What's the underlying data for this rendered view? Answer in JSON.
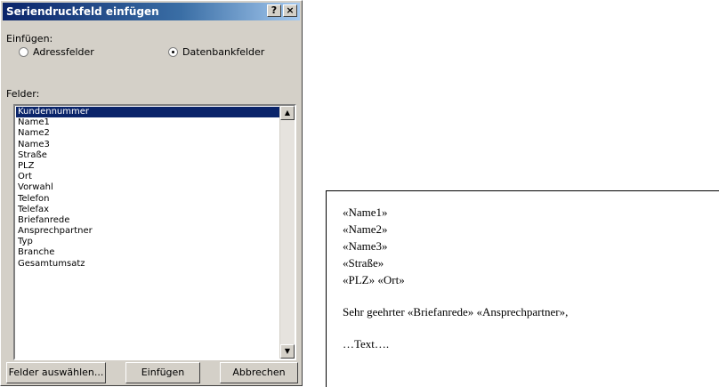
{
  "dialog": {
    "title": "Seriendruckfeld einfügen",
    "help_glyph": "?",
    "close_glyph": "×",
    "insert_label": "Einfügen:",
    "radio_address": "Adressfelder",
    "radio_database": "Datenbankfelder",
    "selected_radio": "Datenbankfelder",
    "fields_label": "Felder:",
    "fields": [
      "Kundennummer",
      "Name1",
      "Name2",
      "Name3",
      "Straße",
      "PLZ",
      "Ort",
      "Vorwahl",
      "Telefon",
      "Telefax",
      "Briefanrede",
      "Ansprechpartner",
      "Typ",
      "Branche",
      "Gesamtumsatz"
    ],
    "selected_field": "Kundennummer",
    "buttons": {
      "select_fields": "Felder auswählen...",
      "insert": "Einfügen",
      "cancel": "Abbrechen"
    }
  },
  "document": {
    "lines": [
      "«Name1»",
      "«Name2»",
      "«Name3»",
      "«Straße»",
      "«PLZ» «Ort»"
    ],
    "salutation": "Sehr geehrter «Briefanrede» «Ansprechpartner»,",
    "body": "…Text…."
  },
  "colors": {
    "title_bar": "#0a246a",
    "dialog_bg": "#d4d0c8",
    "selection": "#0a246a"
  }
}
